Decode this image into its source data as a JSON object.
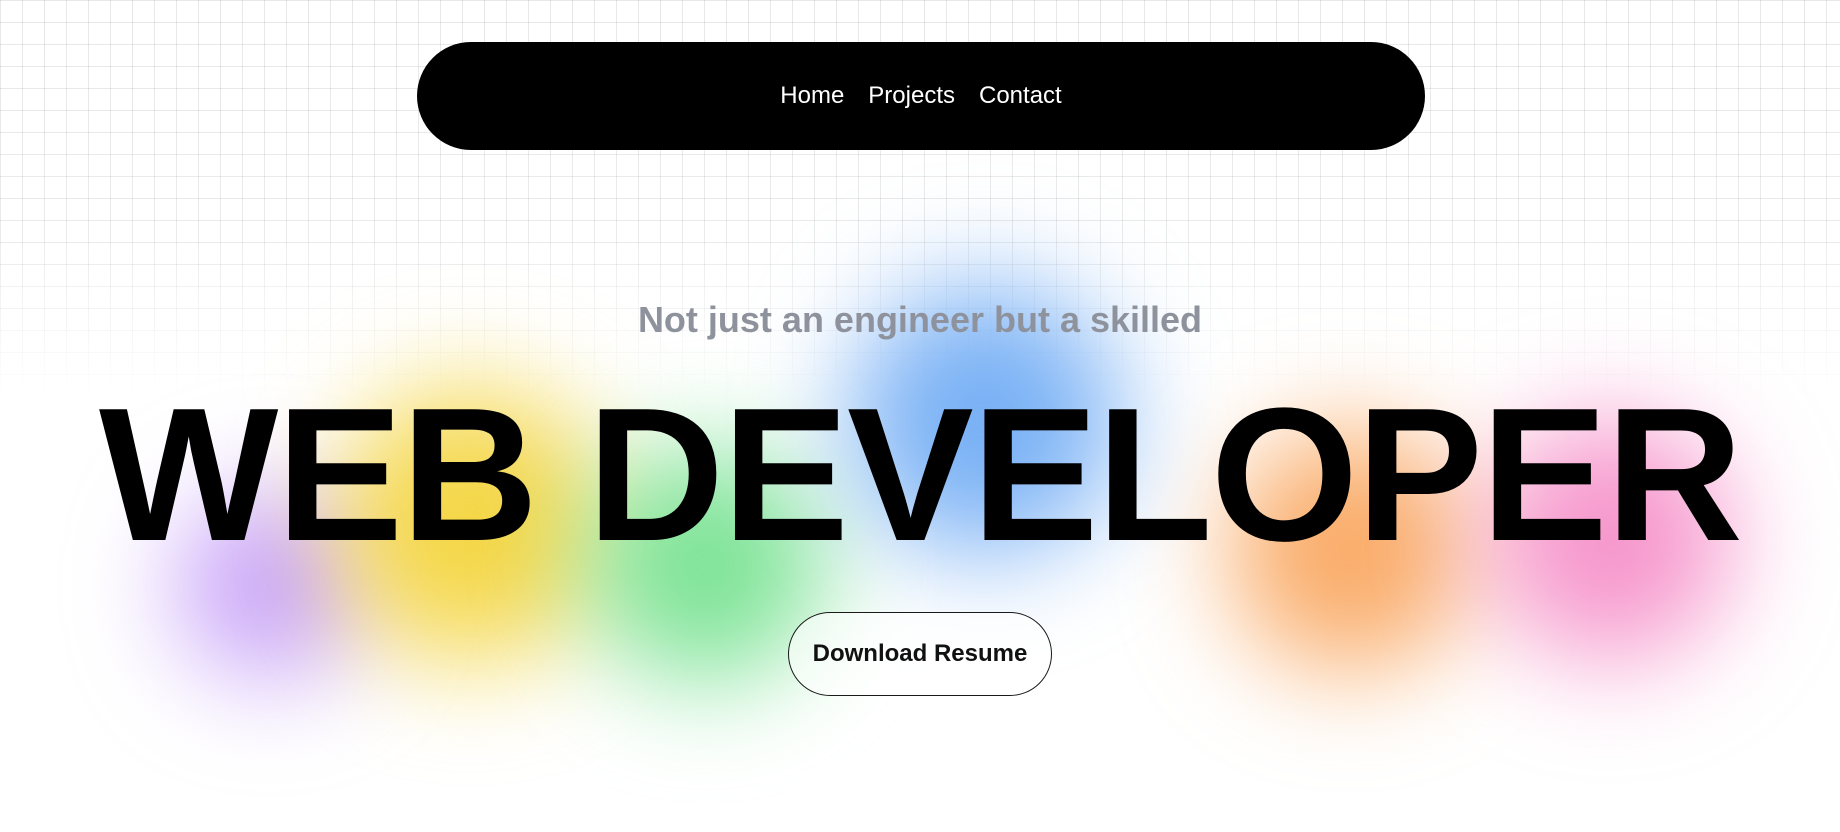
{
  "nav": {
    "items": [
      {
        "label": "Home"
      },
      {
        "label": "Projects"
      },
      {
        "label": "Contact"
      }
    ]
  },
  "hero": {
    "subtitle": "Not just an engineer but a skilled",
    "headline": "WEB DEVELOPER",
    "cta_label": "Download Resume"
  },
  "colors": {
    "navbar_bg": "#000000",
    "subtitle": "#8e929c",
    "headline": "#000000",
    "blob_purple": "#c49cf8",
    "blob_yellow": "#f3d232",
    "blob_green": "#6fe08a",
    "blob_blue": "#6aa8f4",
    "blob_orange": "#f9a257",
    "blob_pink": "#f58ac6"
  }
}
